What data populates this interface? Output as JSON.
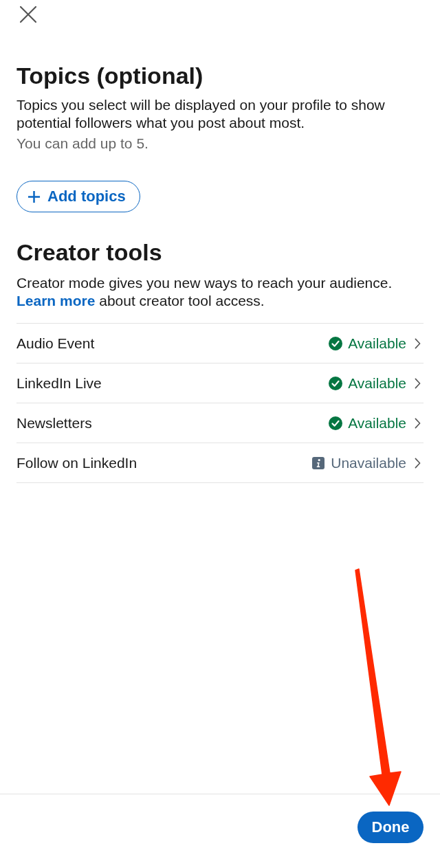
{
  "topics": {
    "title": "Topics (optional)",
    "description": "Topics you select will be displayed on your profile to show potential followers what you post about most.",
    "hint": "You can add up to 5.",
    "add_button": "Add topics"
  },
  "creator_tools": {
    "title": "Creator tools",
    "description": "Creator mode gives you new ways to reach your audience.",
    "link": "Learn more",
    "link_text": "about creator tool access.",
    "tools": [
      {
        "label": "Audio Event",
        "status": "Available",
        "kind": "available"
      },
      {
        "label": "LinkedIn Live",
        "status": "Available",
        "kind": "available"
      },
      {
        "label": "Newsletters",
        "status": "Available",
        "kind": "available"
      },
      {
        "label": "Follow on LinkedIn",
        "status": "Unavailable",
        "kind": "unavailable"
      }
    ]
  },
  "footer": {
    "done_button": "Done"
  }
}
